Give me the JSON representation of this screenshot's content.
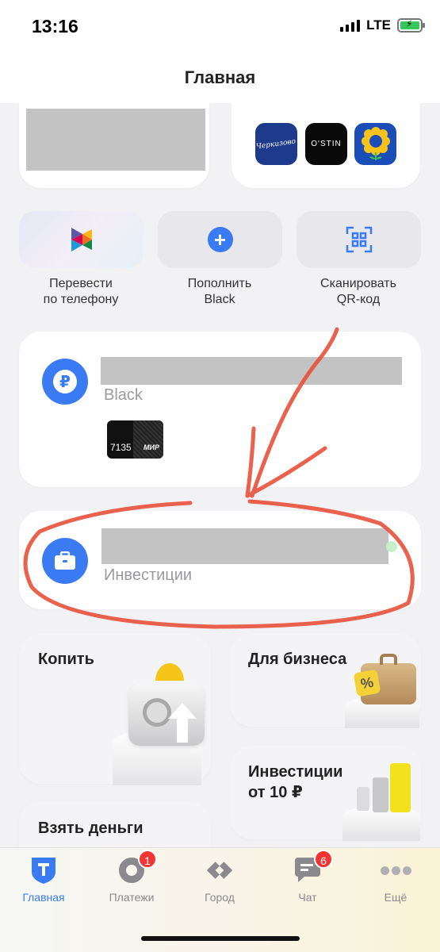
{
  "status_bar": {
    "time": "13:16",
    "network": "LTE"
  },
  "header": {
    "title": "Главная"
  },
  "partners": [
    {
      "name": "Черкизово",
      "bg": "#1e3a8a"
    },
    {
      "name": "O'STIN",
      "bg": "#0a0a0a"
    },
    {
      "name": "sunflower",
      "bg": "#1a4db8"
    }
  ],
  "actions": [
    {
      "label_line1": "Перевести",
      "label_line2": "по телефону"
    },
    {
      "label_line1": "Пополнить",
      "label_line2": "Black"
    },
    {
      "label_line1": "Сканировать",
      "label_line2": "QR-код"
    }
  ],
  "account_black": {
    "subtitle": "Black",
    "card_number": "7135",
    "card_brand": "МИР"
  },
  "account_invest": {
    "subtitle": "Инвестиции"
  },
  "tiles": {
    "save": "Копить",
    "business": "Для бизнеса",
    "invest_line1": "Инвестиции",
    "invest_line2": "от 10 ₽",
    "borrow": "Взять деньги"
  },
  "tabs": [
    {
      "label": "Главная",
      "badge": ""
    },
    {
      "label": "Платежи",
      "badge": "1"
    },
    {
      "label": "Город",
      "badge": ""
    },
    {
      "label": "Чат",
      "badge": "6"
    },
    {
      "label": "Ещё",
      "badge": ""
    }
  ],
  "colors": {
    "accent": "#3a7bf3",
    "annotation": "#e8503a",
    "badge": "#f23434"
  }
}
